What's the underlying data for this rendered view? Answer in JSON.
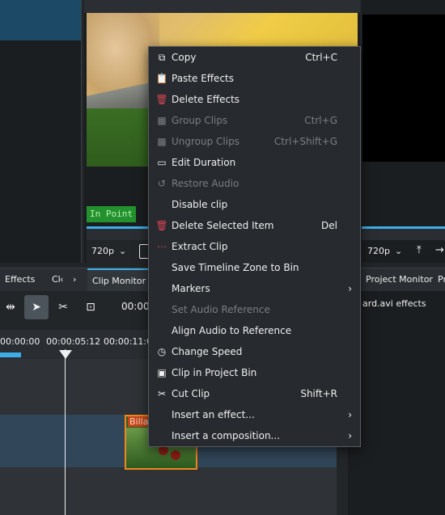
{
  "clip_monitor": {
    "in_point_label": "In Point",
    "zoom": "720p",
    "tab_label": "Clip Monitor"
  },
  "project_monitor": {
    "zoom": "720p",
    "tab_label": "Project Monitor"
  },
  "tabs": {
    "effects": "Effects",
    "clips_truncated": "Cl",
    "last_truncated": "Pr"
  },
  "timeline": {
    "timecode": "00:00",
    "ruler_labels": [
      "00:00:00",
      "00:00:05:12",
      "00:00:11:0"
    ],
    "clip_name": "Billar"
  },
  "effects_panel": {
    "title": "ard.avi effects"
  },
  "context_menu": {
    "items": [
      {
        "label": "Copy",
        "shortcut": "Ctrl+C",
        "icon": "copy-icon",
        "enabled": true
      },
      {
        "label": "Paste Effects",
        "shortcut": "",
        "icon": "paste-icon",
        "enabled": true
      },
      {
        "label": "Delete Effects",
        "shortcut": "",
        "icon": "trash-icon",
        "enabled": true
      },
      {
        "label": "Group Clips",
        "shortcut": "Ctrl+G",
        "icon": "group-icon",
        "enabled": false
      },
      {
        "label": "Ungroup Clips",
        "shortcut": "Ctrl+Shift+G",
        "icon": "ungroup-icon",
        "enabled": false
      },
      {
        "label": "Edit Duration",
        "shortcut": "",
        "icon": "duration-icon",
        "enabled": true
      },
      {
        "label": "Restore Audio",
        "shortcut": "",
        "icon": "restore-audio-icon",
        "enabled": false
      },
      {
        "label": "Disable clip",
        "shortcut": "",
        "icon": "",
        "enabled": true
      },
      {
        "label": "Delete Selected Item",
        "shortcut": "Del",
        "icon": "trash-icon",
        "enabled": true
      },
      {
        "label": "Extract Clip",
        "shortcut": "",
        "icon": "extract-icon",
        "enabled": true
      },
      {
        "label": "Save Timeline Zone to Bin",
        "shortcut": "",
        "icon": "",
        "enabled": true
      },
      {
        "label": "Markers",
        "shortcut": "",
        "icon": "",
        "enabled": true,
        "submenu": true
      },
      {
        "label": "Set Audio Reference",
        "shortcut": "",
        "icon": "",
        "enabled": false
      },
      {
        "label": "Align Audio to Reference",
        "shortcut": "",
        "icon": "",
        "enabled": true
      },
      {
        "label": "Change Speed",
        "shortcut": "",
        "icon": "speed-icon",
        "enabled": true
      },
      {
        "label": "Clip in Project Bin",
        "shortcut": "",
        "icon": "bin-icon",
        "enabled": true
      },
      {
        "label": "Cut Clip",
        "shortcut": "Shift+R",
        "icon": "scissors-icon",
        "enabled": true
      },
      {
        "label": "Insert an effect...",
        "shortcut": "",
        "icon": "",
        "enabled": true,
        "submenu": true
      },
      {
        "label": "Insert a composition...",
        "shortcut": "",
        "icon": "",
        "enabled": true,
        "submenu": true
      }
    ]
  }
}
